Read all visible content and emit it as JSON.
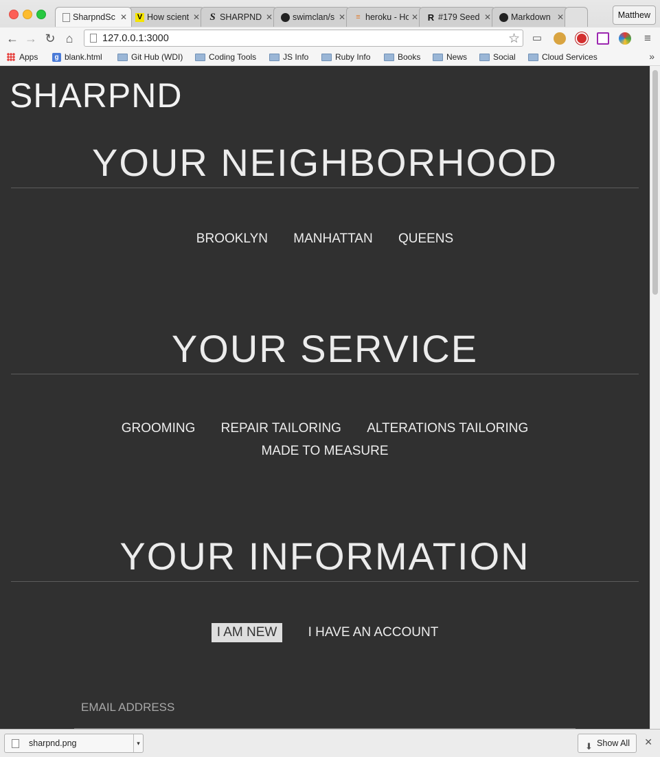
{
  "browser": {
    "tabs": [
      {
        "title": "SharpndSc",
        "icon": "page-icon",
        "active": true
      },
      {
        "title": "How scient",
        "icon": "verge-icon",
        "active": false
      },
      {
        "title": "SHARPND",
        "icon": "s-logo-icon",
        "active": false
      },
      {
        "title": "swimclan/s",
        "icon": "github-icon",
        "active": false
      },
      {
        "title": "heroku - Ho",
        "icon": "stackoverflow-icon",
        "active": false
      },
      {
        "title": "#179 Seed",
        "icon": "railscasts-icon",
        "active": false
      },
      {
        "title": "Markdown",
        "icon": "github-icon",
        "active": false
      }
    ],
    "profile": "Matthew",
    "url": "127.0.0.1:3000",
    "bookmarks": [
      {
        "label": "Apps",
        "icon": "apps-grid-icon"
      },
      {
        "label": "blank.html",
        "icon": "google-icon"
      },
      {
        "label": "Git Hub (WDI)",
        "icon": "folder-icon"
      },
      {
        "label": "Coding Tools",
        "icon": "folder-icon"
      },
      {
        "label": "JS Info",
        "icon": "folder-icon"
      },
      {
        "label": "Ruby Info",
        "icon": "folder-icon"
      },
      {
        "label": "Books",
        "icon": "folder-icon"
      },
      {
        "label": "News",
        "icon": "folder-icon"
      },
      {
        "label": "Social",
        "icon": "folder-icon"
      },
      {
        "label": "Cloud Services",
        "icon": "folder-icon"
      }
    ],
    "bookmarks_more": "»"
  },
  "page": {
    "logo": "SHARPND",
    "neighborhood": {
      "title": "YOUR NEIGHBORHOOD",
      "options": [
        "BROOKLYN",
        "MANHATTAN",
        "QUEENS"
      ]
    },
    "service": {
      "title": "YOUR SERVICE",
      "options": [
        "GROOMING",
        "REPAIR TAILORING",
        "ALTERATIONS TAILORING",
        "MADE TO MEASURE"
      ]
    },
    "information": {
      "title": "YOUR INFORMATION",
      "options": [
        "I AM NEW",
        "I HAVE AN ACCOUNT"
      ],
      "selected": "I AM NEW",
      "email_placeholder": "EMAIL ADDRESS"
    }
  },
  "downloads": {
    "file_name": "sharpnd.png",
    "show_all": "Show All"
  }
}
